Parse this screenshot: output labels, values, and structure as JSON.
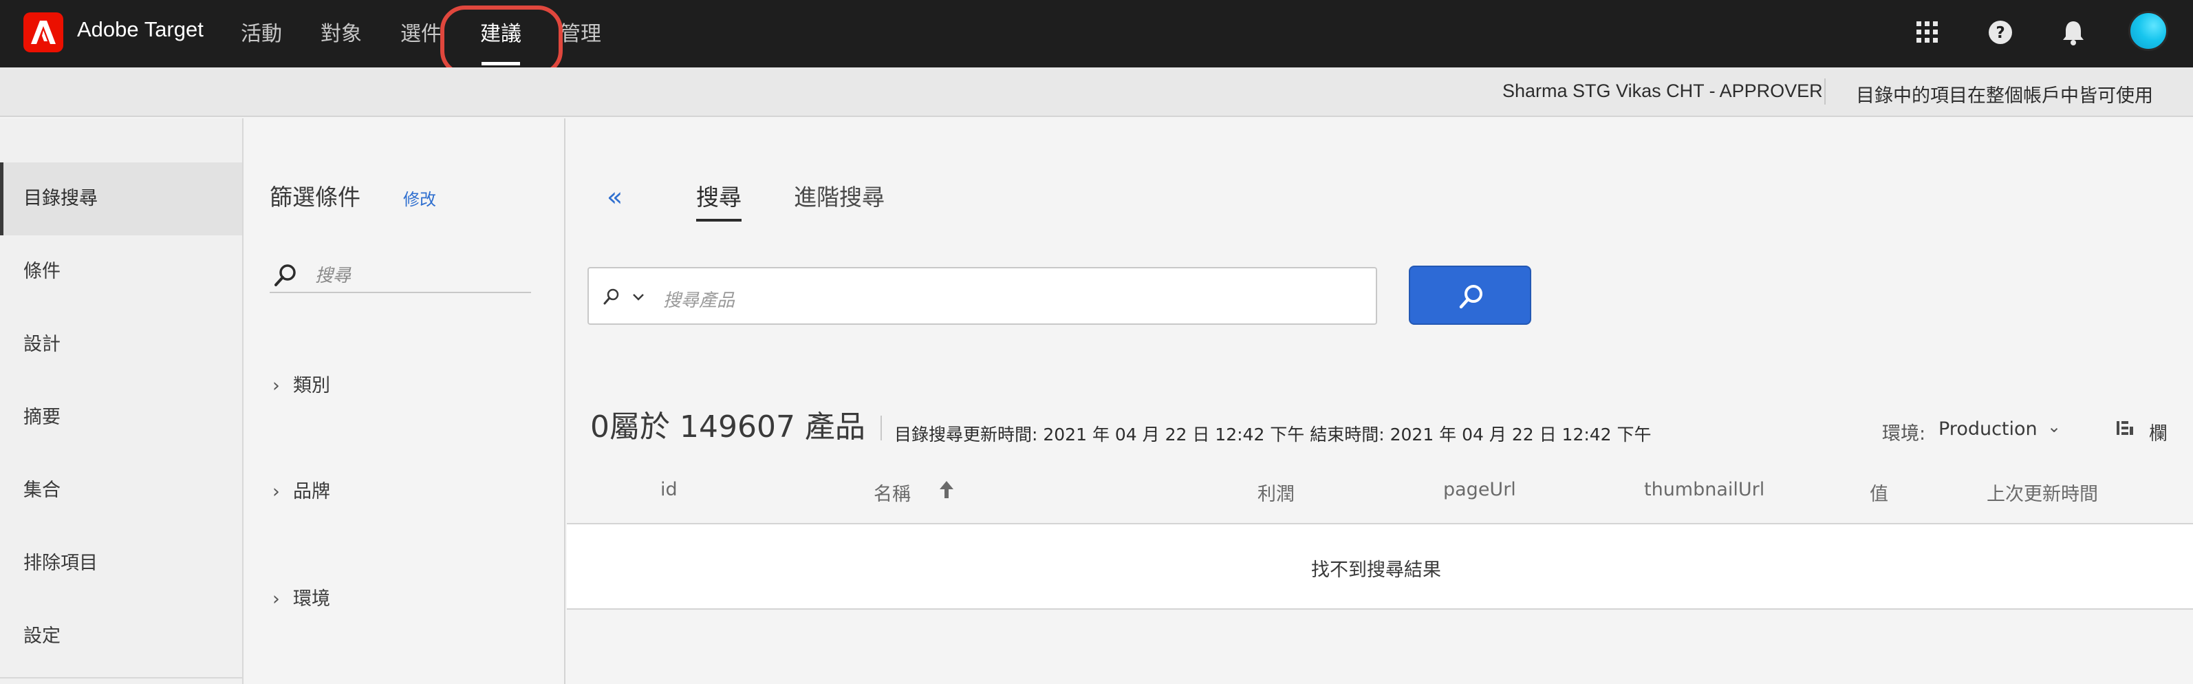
{
  "app": {
    "title": "Adobe Target"
  },
  "nav": {
    "items": [
      {
        "label": "活動"
      },
      {
        "label": "對象"
      },
      {
        "label": "選件"
      },
      {
        "label": "建議"
      },
      {
        "label": "管理"
      }
    ],
    "active": "建議"
  },
  "top_icons": [
    "apps-grid-icon",
    "help-icon",
    "notification-bell-icon",
    "user-avatar"
  ],
  "subheader": {
    "user": "Sharma STG Vikas CHT - APPROVER",
    "note": "目錄中的項目在整個帳戶中皆可使用"
  },
  "sidebar": {
    "items": [
      {
        "label": "目錄搜尋"
      },
      {
        "label": "條件"
      },
      {
        "label": "設計"
      },
      {
        "label": "摘要"
      },
      {
        "label": "集合"
      },
      {
        "label": "排除項目"
      },
      {
        "label": "設定"
      }
    ],
    "active": "目錄搜尋"
  },
  "filters": {
    "title": "篩選條件",
    "edit_label": "修改",
    "search_placeholder": "搜尋",
    "facets": [
      {
        "label": "類別"
      },
      {
        "label": "品牌"
      },
      {
        "label": "環境"
      }
    ]
  },
  "main": {
    "collapse_label": "«",
    "tabs": [
      {
        "label": "搜尋"
      },
      {
        "label": "進階搜尋"
      }
    ],
    "active_tab": "搜尋",
    "search_placeholder": "搜尋產品",
    "result_count": "0屬於 149607 產品",
    "result_meta": "目錄搜尋更新時間: 2021 年 04 月 22 日 12:42 下午 結束時間: 2021 年 04 月 22 日 12:42 下午",
    "environment_label": "環境:",
    "environment_value": "Production",
    "columns_label": "欄",
    "table_headers": [
      "id",
      "名稱",
      "利潤",
      "pageUrl",
      "thumbnailUrl",
      "值",
      "上次更新時間"
    ],
    "sort_column": "名稱",
    "sort_direction": "ascending",
    "empty_message": "找不到搜尋結果"
  },
  "colors": {
    "topbar": "#1e1e1e",
    "adobe_red": "#eb1000",
    "accent_blue": "#2d6ad6",
    "highlight_ring": "#e0473d"
  }
}
